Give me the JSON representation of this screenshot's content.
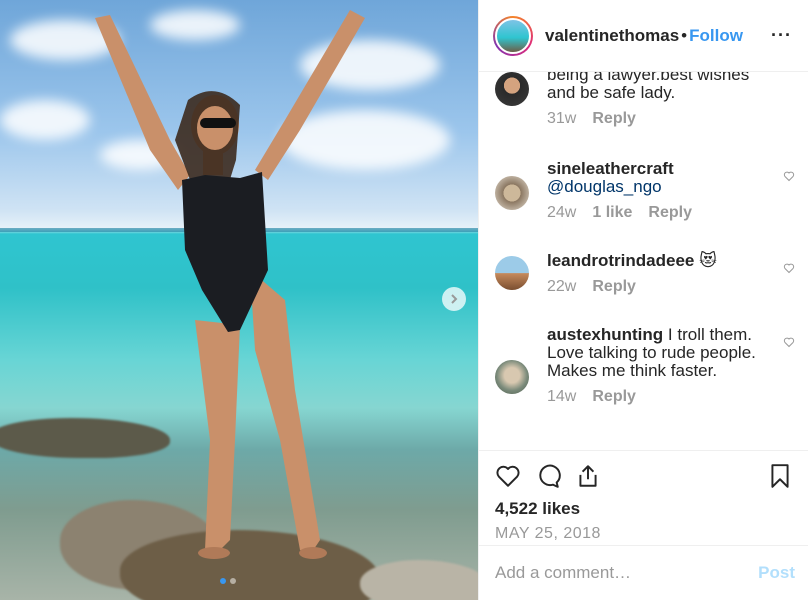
{
  "post": {
    "image_alt": "photo",
    "carousel": {
      "count": 2,
      "active": 1
    }
  },
  "header": {
    "username": "valentinethomas",
    "separator": "•",
    "follow_label": "Follow",
    "more_label": "···"
  },
  "comments": [
    {
      "user": "",
      "text": "being a lawyer.best wishes and be safe lady.",
      "time": "31w",
      "likes": "",
      "reply": "Reply"
    },
    {
      "user": "sineleathercraft",
      "mention": "@douglas_ngo",
      "text": "",
      "time": "24w",
      "likes": "1 like",
      "reply": "Reply"
    },
    {
      "user": "leandrotrindadeee",
      "text": "😻",
      "time": "22w",
      "likes": "",
      "reply": "Reply"
    },
    {
      "user": "austexhunting",
      "text": "I troll them. Love talking to rude people. Makes me think faster.",
      "time": "14w",
      "likes": "",
      "reply": "Reply"
    }
  ],
  "actions": {
    "likes": "4,522 likes",
    "date": "MAY 25, 2018"
  },
  "add_comment": {
    "placeholder": "Add a comment…",
    "post_label": "Post"
  },
  "colors": {
    "accent": "#3897f0",
    "post_disabled": "#b2dffc",
    "meta": "#999999"
  }
}
